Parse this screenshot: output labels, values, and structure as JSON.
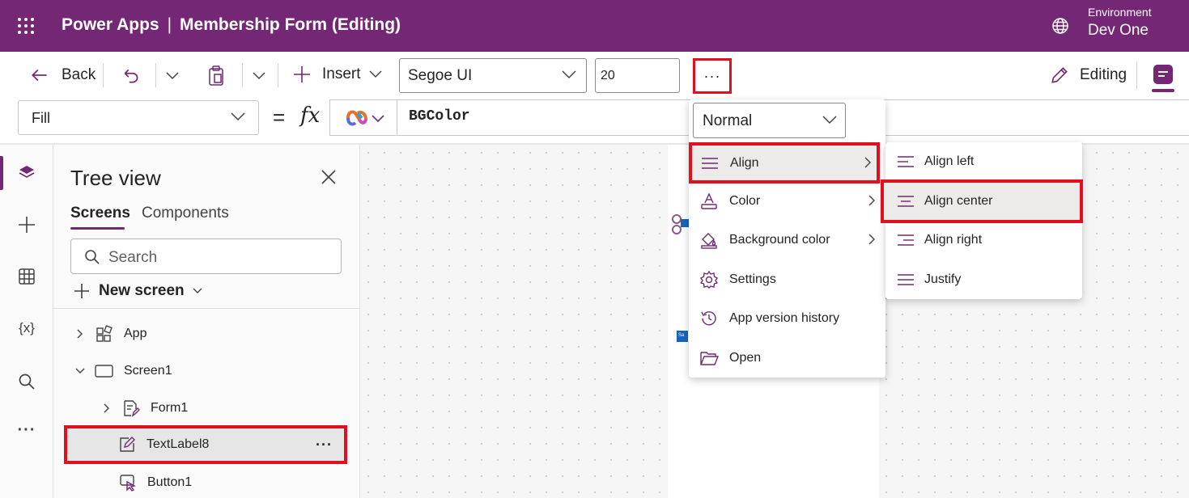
{
  "header": {
    "app_name": "Power Apps",
    "separator": "|",
    "document_title": "Membership Form (Editing)",
    "environment_label": "Environment",
    "environment_name": "Dev One",
    "background_color": "#742774"
  },
  "toolbar": {
    "back_label": "Back",
    "insert_label": "Insert",
    "font_family_value": "Segoe UI",
    "font_size_value": "20",
    "more_label": "···",
    "editing_label": "Editing"
  },
  "formula_bar": {
    "property_value": "Fill",
    "equals": "=",
    "fx": "fx",
    "formula": "BGColor"
  },
  "rail": {
    "items": [
      "layers-icon",
      "plus-icon",
      "table-icon",
      "variables-icon",
      "search-icon",
      "more-icon"
    ],
    "variables_glyph": "{x}"
  },
  "tree_view": {
    "title": "Tree view",
    "tabs": [
      "Screens",
      "Components"
    ],
    "search_placeholder": "Search",
    "new_screen_label": "New screen",
    "nodes": [
      {
        "label": "App",
        "icon": "app-icon"
      },
      {
        "label": "Screen1",
        "icon": "screen-icon"
      },
      {
        "label": "Form1",
        "icon": "form-icon"
      },
      {
        "label": "TextLabel8",
        "icon": "edit-label-icon"
      },
      {
        "label": "Button1",
        "icon": "button-icon"
      }
    ],
    "row_more": "···"
  },
  "canvas": {
    "mini_text": "Sa"
  },
  "menu": {
    "text_style_value": "Normal",
    "items": [
      {
        "label": "Align",
        "icon": "align-icon"
      },
      {
        "label": "Color",
        "icon": "text-color-icon"
      },
      {
        "label": "Background color",
        "icon": "paint-bucket-icon"
      },
      {
        "label": "Settings",
        "icon": "settings-icon"
      },
      {
        "label": "App version history",
        "icon": "history-icon"
      },
      {
        "label": "Open",
        "icon": "folder-icon"
      }
    ]
  },
  "align_submenu": {
    "items": [
      {
        "label": "Align left",
        "icon": "align-left-icon"
      },
      {
        "label": "Align center",
        "icon": "align-center-icon"
      },
      {
        "label": "Align right",
        "icon": "align-right-icon"
      },
      {
        "label": "Justify",
        "icon": "justify-icon"
      }
    ]
  },
  "colors": {
    "highlight_border": "#e0101e",
    "accent": "#742774"
  }
}
